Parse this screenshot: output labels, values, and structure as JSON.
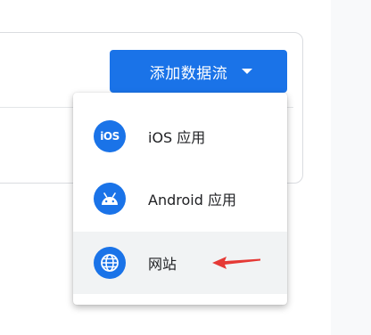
{
  "header": {
    "add_stream_label": "添加数据流",
    "add_stream_caret_icon": "caret-down-icon"
  },
  "menu": {
    "items": [
      {
        "label": "iOS 应用",
        "icon": "ios-icon",
        "icon_text": "iOS"
      },
      {
        "label": "Android 应用",
        "icon": "android-icon"
      },
      {
        "label": "网站",
        "icon": "globe-icon",
        "highlighted": true
      }
    ]
  },
  "annotation": {
    "icon": "red-arrow-icon",
    "color": "#e53935"
  },
  "colors": {
    "primary": "#1a73e8",
    "menu_highlight": "#f1f3f4",
    "side_panel": "#f8f9fa"
  }
}
